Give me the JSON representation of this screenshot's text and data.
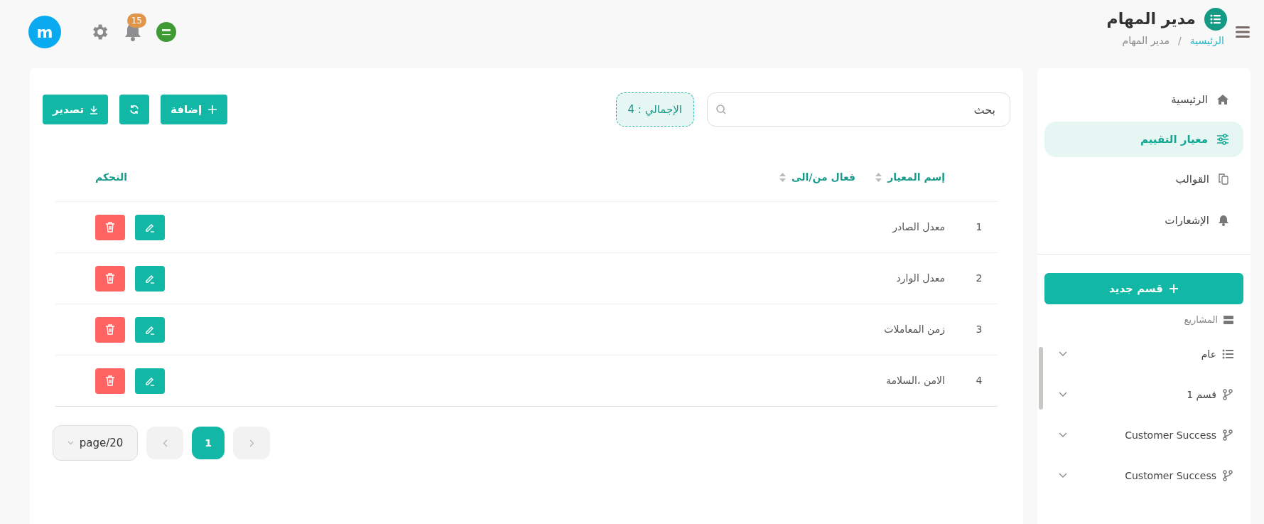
{
  "header": {
    "title": "مدير المهام",
    "breadcrumb_separator": "/",
    "breadcrumb": [
      {
        "label": "الرئيسية",
        "link": true
      },
      {
        "label": "مدير المهام",
        "link": false
      }
    ],
    "notification_count": "15",
    "user_initial": "m"
  },
  "sidebar": {
    "items": [
      {
        "label": "الرئيسية",
        "kind": "home",
        "selected": false
      },
      {
        "label": "معيار التقييم",
        "kind": "sliders",
        "selected": true
      },
      {
        "label": "القوالب",
        "kind": "copy",
        "selected": false
      },
      {
        "label": "الإشعارات",
        "kind": "bell",
        "selected": false
      }
    ],
    "new_section_button": "قسم جديد",
    "projects_label": "المشاريع",
    "projects": [
      {
        "label": "عام",
        "kind": "list"
      },
      {
        "label": "قسم 1",
        "kind": "branch"
      },
      {
        "label": "Customer Success",
        "kind": "branch"
      },
      {
        "label": "Customer Success",
        "kind": "branch"
      }
    ]
  },
  "toolbar": {
    "search_placeholder": "بحث",
    "total": "الإجمالي : 4",
    "add_button": "إضافة",
    "export_button": "تصدير"
  },
  "table": {
    "columns": [
      {
        "label": "إسم المعيار",
        "sortable": true
      },
      {
        "label": "فعال من/الى",
        "sortable": true
      },
      {
        "label": "التحكم",
        "sortable": false
      }
    ],
    "rows": [
      {
        "index": "1",
        "name": "معدل الصادر"
      },
      {
        "index": "2",
        "name": "معدل الوارد"
      },
      {
        "index": "3",
        "name": "زمن المعاملات"
      },
      {
        "index": "4",
        "name": "الامن ،السلامة"
      }
    ]
  },
  "pagination": {
    "page_size": "page/20",
    "pages": [
      {
        "label": "1",
        "selected": true
      }
    ]
  }
}
